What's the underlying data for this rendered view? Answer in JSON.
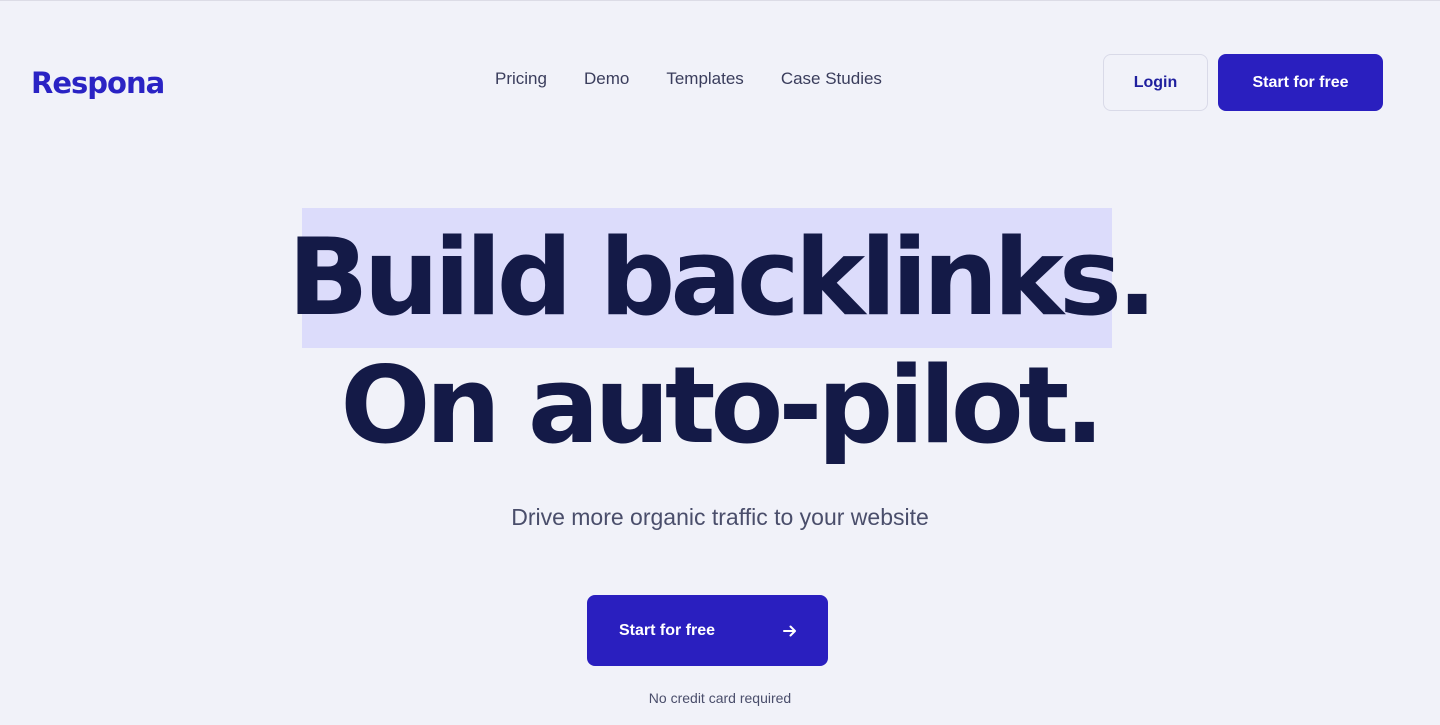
{
  "header": {
    "logo_text": "Respona",
    "nav": [
      {
        "label": "Pricing"
      },
      {
        "label": "Demo"
      },
      {
        "label": "Templates"
      },
      {
        "label": "Case Studies"
      }
    ],
    "login_label": "Login",
    "start_label": "Start for free"
  },
  "hero": {
    "headline_line1": "Build backlinks.",
    "headline_line2": "On auto-pilot.",
    "subtitle": "Drive more organic traffic to your website",
    "cta_label": "Start for free",
    "cta_icon": "arrow-right-icon",
    "note": "No credit card required"
  },
  "colors": {
    "background": "#f1f2f9",
    "brand": "#2a1fbf",
    "headline": "#141a47",
    "highlight": "#dcdcfb"
  }
}
